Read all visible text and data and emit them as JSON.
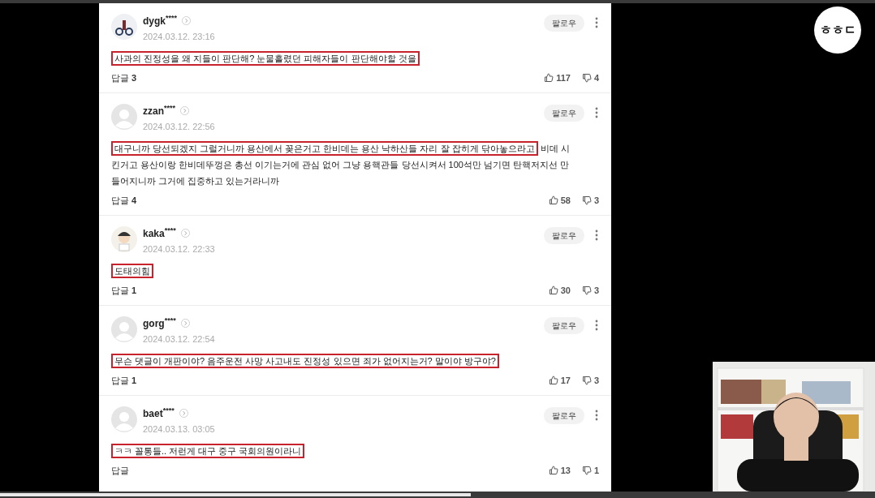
{
  "logo": {
    "text": "ㅎㅎㄷ"
  },
  "comments": [
    {
      "user": "dygk$^{****}$",
      "date": "2024.03.12. 23:16",
      "follow": "팔로우",
      "highlight": "사과의 진정성을 왜 지들이 판단해? 눈물흘렸던 피해자들이 판단해야할 것을",
      "reply_label": "답글",
      "reply_count": "3",
      "likes": "117",
      "dislikes": "4"
    },
    {
      "kind": "default",
      "user": "zzan$^{****}$",
      "date": "2024.03.12. 22:56",
      "follow": "팔로우",
      "highlight": "대구니까 당선되겠지 그럴거니까 용산에서 꽂은거고 한비데는 용산 낙하산들 자리 잘 잡히게 닦아놓으라고",
      "rest": "비데 시킨거고 용산이랑 한비데뚜껑은 총선 이기는거에 관심 없어 그냥 용핵관들 당선시켜서 100석만 넘기면 탄핵저지선 만들어지니까 그거에 집중하고 있는거라니까",
      "reply_label": "답글",
      "reply_count": "4",
      "likes": "58",
      "dislikes": "3"
    },
    {
      "kind": "cartoon",
      "user": "kaka$^{****}$",
      "date": "2024.03.12. 22:33",
      "follow": "팔로우",
      "highlight": "도태의힘",
      "reply_label": "답글",
      "reply_count": "1",
      "likes": "30",
      "dislikes": "3"
    },
    {
      "kind": "default",
      "user": "gorg$^{****}$",
      "date": "2024.03.12. 22:54",
      "follow": "팔로우",
      "highlight": "무슨 댓글이 개판이야? 음주운전 사망 사고내도 진정성 있으면 죄가 없어지는거? 말이야 방구야?",
      "reply_label": "답글",
      "reply_count": "1",
      "likes": "17",
      "dislikes": "3"
    },
    {
      "kind": "default",
      "user": "baet$^{****}$",
      "date": "2024.03.13. 03:05",
      "follow": "팔로우",
      "highlight": "ㅋㅋ 꼴통들.. 저런게 대구 중구 국회의원이라니",
      "reply_label": "답글",
      "likes": "13",
      "dislikes": "1"
    }
  ]
}
